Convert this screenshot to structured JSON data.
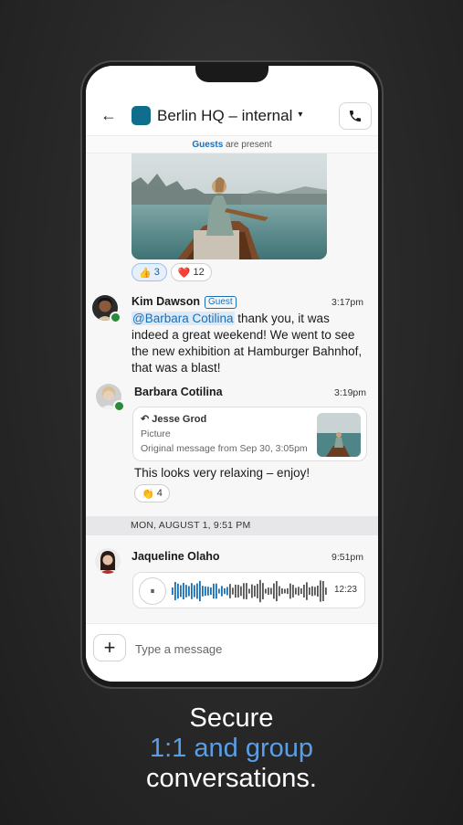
{
  "header": {
    "back_label": "←",
    "title": "Berlin HQ – internal",
    "caret": "▾"
  },
  "guests_bar": {
    "link": "Guests",
    "text": " are present"
  },
  "photo_reactions": [
    {
      "emoji": "👍",
      "count": "3"
    },
    {
      "emoji": "❤️",
      "count": "12"
    }
  ],
  "messages": [
    {
      "author": "Kim Dawson",
      "badge": "Guest",
      "time": "3:17pm",
      "mention": "@Barbara Cotilina",
      "text": " thank you, it was indeed a great weekend! We went to see the new exhibition at Hamburger Bahnhof, that was a blast!"
    },
    {
      "author": "Barbara Cotilina",
      "time": "3:19pm",
      "quote": {
        "author": "Jesse Grod",
        "subtitle": "Picture",
        "original": "Original message from Sep 30, 3:05pm",
        "reply_icon": "↶"
      },
      "text": "This looks very relaxing – enjoy!",
      "reaction": {
        "emoji": "👏",
        "count": "4"
      }
    },
    {
      "author": "Jaqueline Olaho",
      "time": "9:51pm",
      "audio": {
        "play_icon": "⏸",
        "duration": "12:23"
      }
    }
  ],
  "date_separator": "MON, AUGUST 1, 9:51 PM",
  "composer": {
    "add_label": "+",
    "placeholder": "Type a message"
  },
  "tagline": {
    "line1": "Secure",
    "line2": "1:1 and group",
    "line3": "conversations."
  },
  "colors": {
    "accent": "#1b6fb5",
    "avatar": "#0f6e8c",
    "tagline_highlight": "#5a9ee8",
    "online": "#2a8a3a"
  },
  "icons": [
    "back-arrow-icon",
    "chevron-down-icon",
    "phone-icon",
    "reply-icon",
    "pause-icon",
    "plus-icon"
  ]
}
